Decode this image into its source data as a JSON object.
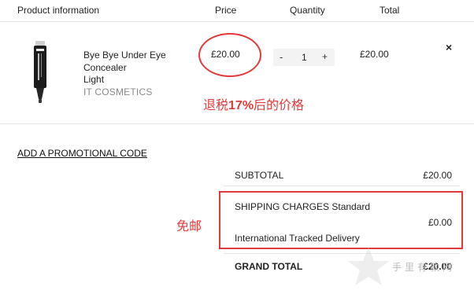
{
  "header": {
    "product_info": "Product information",
    "price": "Price",
    "quantity": "Quantity",
    "total": "Total"
  },
  "item": {
    "name": "Bye Bye Under Eye Concealer",
    "shade": "Light",
    "brand": "IT COSMETICS",
    "price": "£20.00",
    "quantity": "1",
    "minus": "-",
    "plus": "+",
    "total": "£20.00",
    "remove": "×"
  },
  "annotations": {
    "tax_refund_prefix": "退税",
    "tax_refund_percent": "17%",
    "tax_refund_suffix": "后的价格",
    "free_shipping": "免邮",
    "color": "#e23a3a"
  },
  "promo": {
    "link": "ADD A PROMOTIONAL CODE"
  },
  "summary": {
    "subtotal_label": "SUBTOTAL",
    "subtotal_value": "£20.00",
    "shipping_label": "SHIPPING CHARGES",
    "shipping_method": "Standard",
    "shipping_value": "£0.00",
    "shipping_detail": "International Tracked Delivery",
    "grand_total_label": "GRAND TOTAL",
    "grand_total_value": "£20.00"
  },
  "watermark": {
    "text": "手里有款网"
  }
}
